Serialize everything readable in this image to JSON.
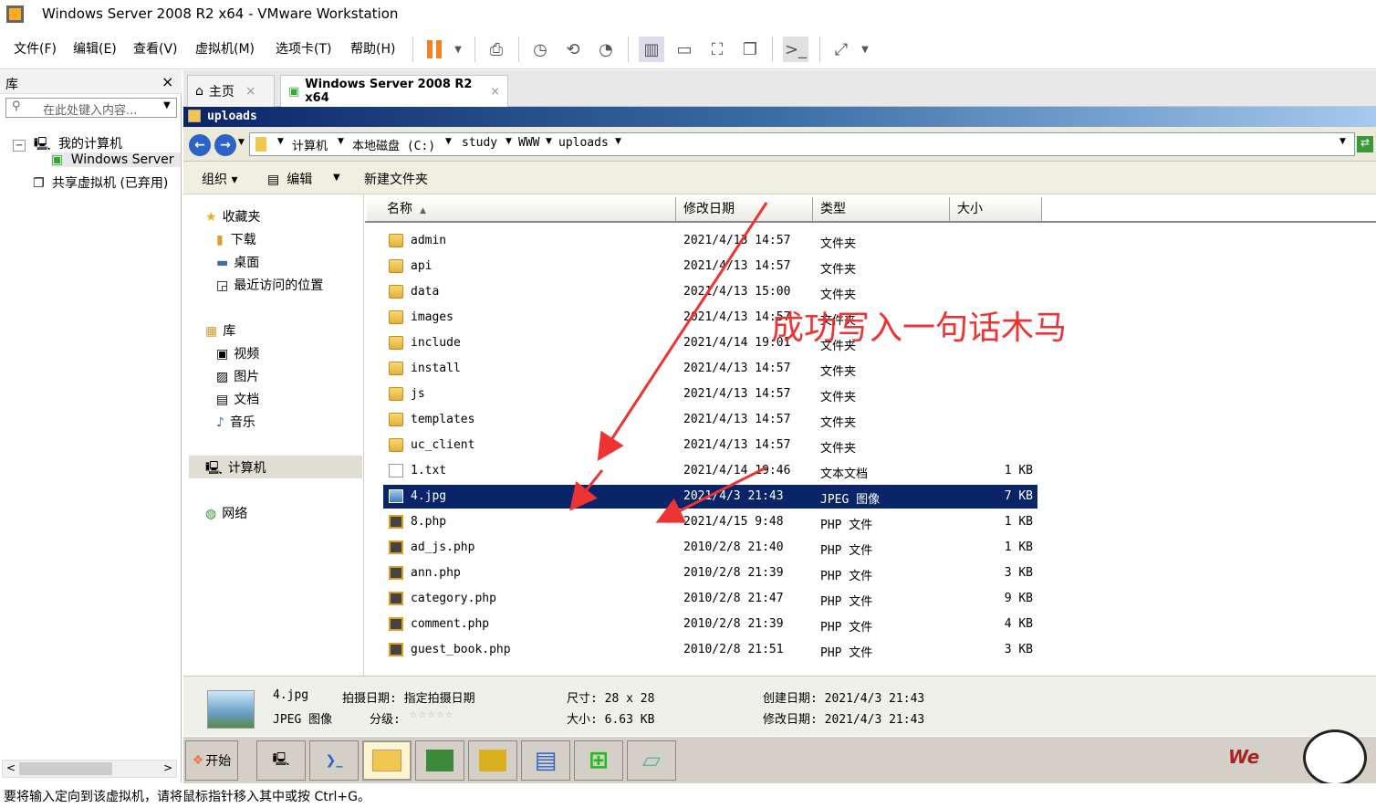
{
  "window": {
    "title": "Windows Server 2008 R2 x64 - VMware Workstation"
  },
  "menu": [
    "文件(F)",
    "编辑(E)",
    "查看(V)",
    "虚拟机(M)",
    "选项卡(T)",
    "帮助(H)"
  ],
  "library": {
    "title": "库",
    "close": "×",
    "search_placeholder": "在此处键入内容...",
    "tree": {
      "my_computer": "我的计算机",
      "vm_item": "Windows Server",
      "shared": "共享虚拟机 (已弃用)"
    }
  },
  "tabs": [
    {
      "label": "主页"
    },
    {
      "label": "Windows Server 2008 R2 x64"
    }
  ],
  "explorer": {
    "title": "uploads",
    "breadcrumb": [
      "计算机",
      "本地磁盘 (C:)",
      "study",
      "WWW",
      "uploads"
    ],
    "commands": {
      "organize": "组织",
      "edit": "编辑",
      "new_folder": "新建文件夹"
    },
    "nav": {
      "favorites": "收藏夹",
      "downloads": "下载",
      "desktop": "桌面",
      "recent": "最近访问的位置",
      "libraries": "库",
      "videos": "视频",
      "pictures": "图片",
      "documents": "文档",
      "music": "音乐",
      "computer": "计算机",
      "network": "网络"
    },
    "columns": {
      "name": "名称",
      "date": "修改日期",
      "type": "类型",
      "size": "大小"
    },
    "files": [
      {
        "name": "admin",
        "date": "2021/4/13 14:57",
        "type": "文件夹",
        "size": "",
        "kind": "folder"
      },
      {
        "name": "api",
        "date": "2021/4/13 14:57",
        "type": "文件夹",
        "size": "",
        "kind": "folder"
      },
      {
        "name": "data",
        "date": "2021/4/13 15:00",
        "type": "文件夹",
        "size": "",
        "kind": "folder"
      },
      {
        "name": "images",
        "date": "2021/4/13 14:57",
        "type": "文件夹",
        "size": "",
        "kind": "folder"
      },
      {
        "name": "include",
        "date": "2021/4/14 19:01",
        "type": "文件夹",
        "size": "",
        "kind": "folder"
      },
      {
        "name": "install",
        "date": "2021/4/13 14:57",
        "type": "文件夹",
        "size": "",
        "kind": "folder"
      },
      {
        "name": "js",
        "date": "2021/4/13 14:57",
        "type": "文件夹",
        "size": "",
        "kind": "folder"
      },
      {
        "name": "templates",
        "date": "2021/4/13 14:57",
        "type": "文件夹",
        "size": "",
        "kind": "folder"
      },
      {
        "name": "uc_client",
        "date": "2021/4/13 14:57",
        "type": "文件夹",
        "size": "",
        "kind": "folder"
      },
      {
        "name": "1.txt",
        "date": "2021/4/14 19:46",
        "type": "文本文档",
        "size": "1 KB",
        "kind": "txt"
      },
      {
        "name": "4.jpg",
        "date": "2021/4/3 21:43",
        "type": "JPEG 图像",
        "size": "7 KB",
        "kind": "jpg",
        "selected": true
      },
      {
        "name": "8.php",
        "date": "2021/4/15 9:48",
        "type": "PHP 文件",
        "size": "1 KB",
        "kind": "php"
      },
      {
        "name": "ad_js.php",
        "date": "2010/2/8 21:40",
        "type": "PHP 文件",
        "size": "1 KB",
        "kind": "php"
      },
      {
        "name": "ann.php",
        "date": "2010/2/8 21:39",
        "type": "PHP 文件",
        "size": "3 KB",
        "kind": "php"
      },
      {
        "name": "category.php",
        "date": "2010/2/8 21:47",
        "type": "PHP 文件",
        "size": "9 KB",
        "kind": "php"
      },
      {
        "name": "comment.php",
        "date": "2010/2/8 21:39",
        "type": "PHP 文件",
        "size": "4 KB",
        "kind": "php"
      },
      {
        "name": "guest_book.php",
        "date": "2010/2/8 21:51",
        "type": "PHP 文件",
        "size": "3 KB",
        "kind": "php"
      }
    ],
    "details": {
      "name": "4.jpg",
      "kind": "JPEG 图像",
      "shot_date": "拍摄日期: 指定拍摄日期",
      "rating": "分级:",
      "dims": "尺寸: 28 x 28",
      "size": "大小: 6.63 KB",
      "created": "创建日期: 2021/4/3 21:43",
      "modified": "修改日期: 2021/4/3 21:43"
    }
  },
  "taskbar": {
    "start": "开始"
  },
  "annotation": "成功写入一句话木马",
  "status": "要将输入定向到该虚拟机，请将鼠标指针移入其中或按 Ctrl+G。",
  "colors": {
    "selection": "#0a246a",
    "annotation": "#ee3333",
    "title_gradient_start": "#0a246a"
  }
}
